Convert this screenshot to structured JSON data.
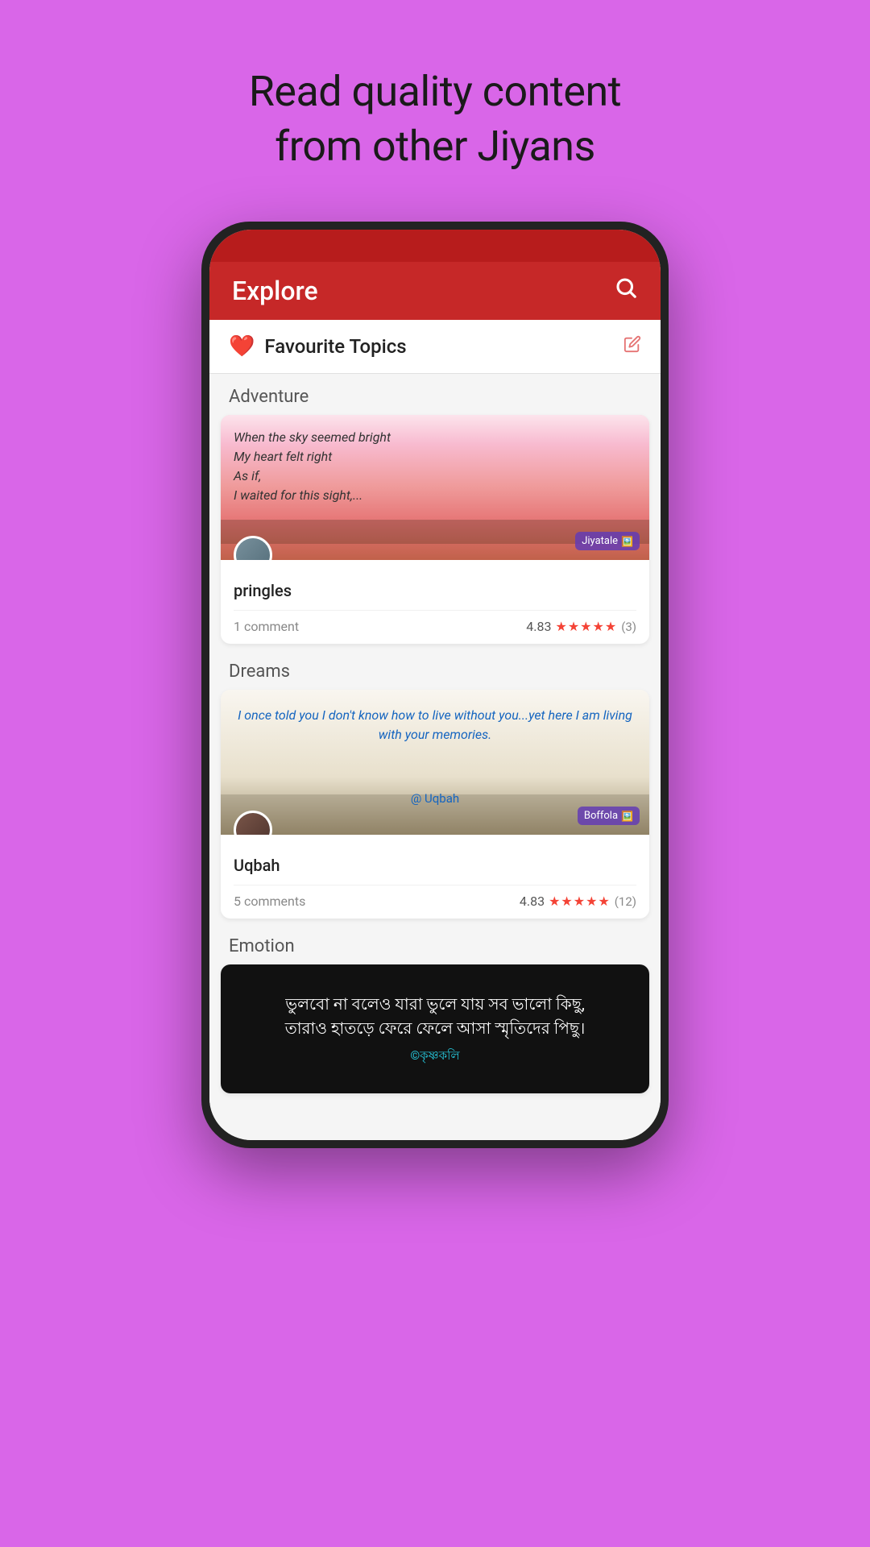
{
  "page": {
    "background_color": "#d966e8",
    "headline_line1": "Read quality content",
    "headline_line2": "from other Jiyans"
  },
  "app": {
    "header_title": "Explore",
    "search_icon": "🔍",
    "favourite_topics_label": "Favourite Topics",
    "edit_icon": "✏️",
    "heart_icon": "♥"
  },
  "sections": [
    {
      "label": "Adventure",
      "cards": [
        {
          "poem_text": "When the sky seemed bright\nMy heart felt right\nAs if,\nI waited for this sight,...",
          "brand": "Jiyatale",
          "username": "pringles",
          "comments": "1 comment",
          "rating": "4.83",
          "rating_count": "(3)"
        }
      ]
    },
    {
      "label": "Dreams",
      "cards": [
        {
          "quote": "I once told you I don't know how to live without you...yet here I am living with your memories.",
          "quote_author": "@ Uqbah",
          "brand": "Boffola",
          "username": "Uqbah",
          "comments": "5 comments",
          "rating": "4.83",
          "rating_count": "(12)"
        }
      ]
    },
    {
      "label": "Emotion",
      "cards": [
        {
          "bengali_text": "ভুলবো না বলেও যারা ভুলে যায় সব ভালো কিছু,\nতারাও হাতড়ে ফেরে ফেলে আসা স্মৃতিদের পিছু।",
          "bengali_author": "©কৃষ্ণকলি"
        }
      ]
    }
  ]
}
